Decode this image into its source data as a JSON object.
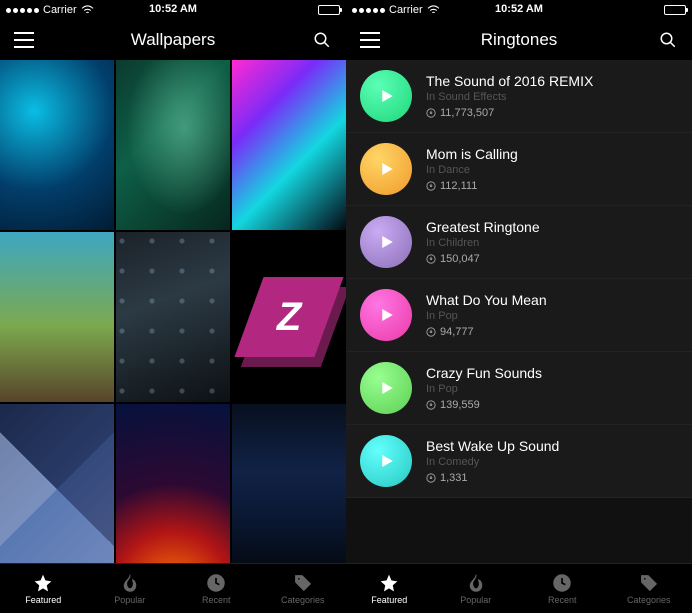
{
  "status": {
    "carrier": "Carrier",
    "time": "10:52 AM"
  },
  "left": {
    "title": "Wallpapers",
    "tiles": [
      "w0",
      "w1",
      "w2",
      "w3",
      "w4",
      "w5",
      "w6",
      "w7",
      "w8"
    ]
  },
  "right": {
    "title": "Ringtones",
    "items": [
      {
        "title": "The Sound of 2016 REMIX",
        "category": "In Sound Effects",
        "downloads": "11,773,507",
        "color": "#1fd67a"
      },
      {
        "title": "Mom is Calling",
        "category": "In Dance",
        "downloads": "112,111",
        "color": "#f09a2a"
      },
      {
        "title": "Greatest Ringtone",
        "category": "In Children",
        "downloads": "150,047",
        "color": "#8d6fb7"
      },
      {
        "title": "What Do You Mean",
        "category": "In Pop",
        "downloads": "94,777",
        "color": "#ea3aa7"
      },
      {
        "title": "Crazy Fun Sounds",
        "category": "In Pop",
        "downloads": "139,559",
        "color": "#5ccf54"
      },
      {
        "title": "Best Wake Up Sound",
        "category": "In Comedy",
        "downloads": "1,331",
        "color": "#27c8c1"
      }
    ]
  },
  "tabs": [
    {
      "label": "Featured",
      "icon": "star"
    },
    {
      "label": "Popular",
      "icon": "flame"
    },
    {
      "label": "Recent",
      "icon": "clock"
    },
    {
      "label": "Categories",
      "icon": "tag"
    }
  ]
}
